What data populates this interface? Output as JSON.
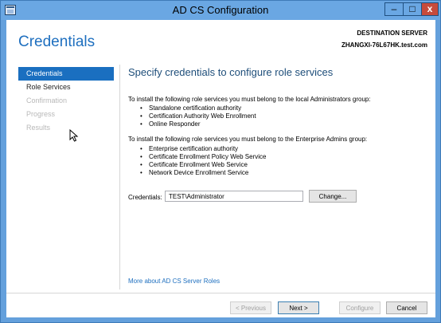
{
  "window": {
    "title": "AD CS Configuration",
    "buttons": {
      "minimize": "–",
      "maximize": "□",
      "close": "x"
    }
  },
  "header": {
    "page_title": "Credentials",
    "destination_label": "DESTINATION SERVER",
    "destination_server": "ZHANGXI-76L67HK.test.com"
  },
  "sidebar": {
    "items": [
      {
        "label": "Credentials",
        "state": "active"
      },
      {
        "label": "Role Services",
        "state": "enabled"
      },
      {
        "label": "Confirmation",
        "state": "disabled"
      },
      {
        "label": "Progress",
        "state": "disabled"
      },
      {
        "label": "Results",
        "state": "disabled"
      }
    ]
  },
  "main": {
    "heading": "Specify credentials to configure role services",
    "local_admin_intro": "To install the following role services you must belong to the local Administrators group:",
    "local_admin_roles": [
      "Standalone certification authority",
      "Certification Authority Web Enrollment",
      "Online Responder"
    ],
    "enterprise_admin_intro": "To install the following role services you must belong to the Enterprise Admins group:",
    "enterprise_admin_roles": [
      "Enterprise certification authority",
      "Certificate Enrollment Policy Web Service",
      "Certificate Enrollment Web Service",
      "Network Device Enrollment Service"
    ],
    "credentials_label": "Credentials:",
    "credentials_value": "TEST\\Administrator",
    "change_button": "Change...",
    "more_link": "More about AD CS Server Roles"
  },
  "footer": {
    "previous": "< Previous",
    "next": "Next >",
    "configure": "Configure",
    "cancel": "Cancel"
  },
  "colors": {
    "accent": "#1a6fc0",
    "title_bar": "#6aa7e3",
    "close_button": "#c74b3c"
  },
  "icons": [
    "app-icon",
    "mouse-pointer-icon"
  ]
}
